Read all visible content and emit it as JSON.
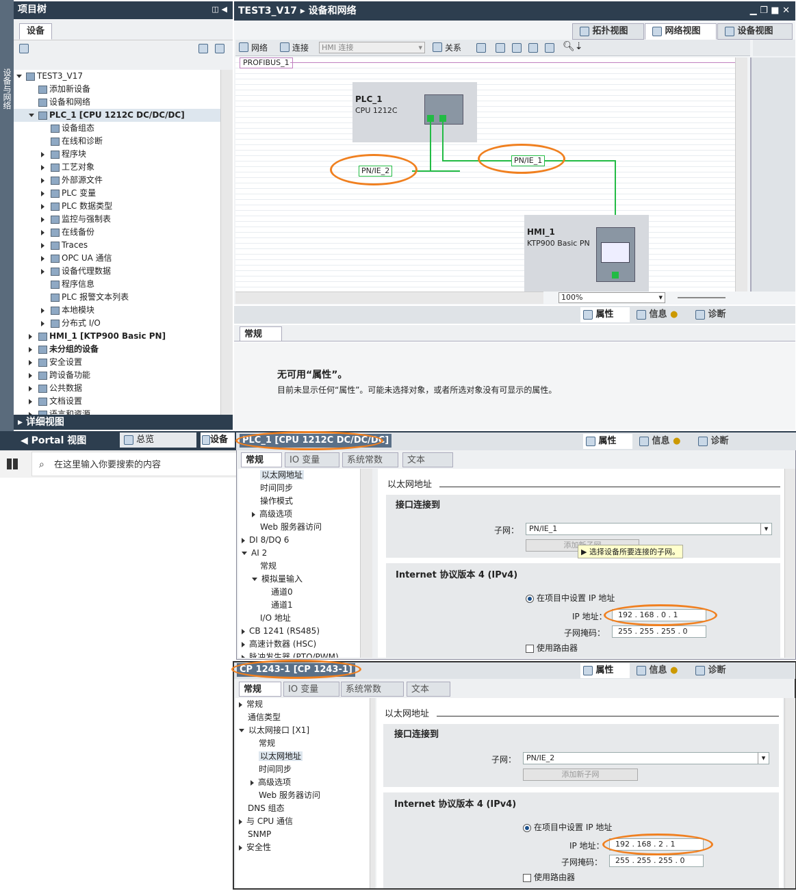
{
  "left": {
    "header": "项目树",
    "tab": "设备",
    "side_label": "设备与网络",
    "items": [
      {
        "label": "TEST3_V17",
        "level": 0,
        "exp": "dn"
      },
      {
        "label": "添加新设备",
        "level": 1,
        "exp": ""
      },
      {
        "label": "设备和网络",
        "level": 1,
        "exp": ""
      },
      {
        "label": "PLC_1 [CPU 1212C DC/DC/DC]",
        "level": 1,
        "exp": "dn"
      },
      {
        "label": "设备组态",
        "level": 2,
        "exp": ""
      },
      {
        "label": "在线和诊断",
        "level": 2,
        "exp": ""
      },
      {
        "label": "程序块",
        "level": 2,
        "exp": "r"
      },
      {
        "label": "工艺对象",
        "level": 2,
        "exp": "r"
      },
      {
        "label": "外部源文件",
        "level": 2,
        "exp": "r"
      },
      {
        "label": "PLC 变量",
        "level": 2,
        "exp": "r"
      },
      {
        "label": "PLC 数据类型",
        "level": 2,
        "exp": "r"
      },
      {
        "label": "监控与强制表",
        "level": 2,
        "exp": "r"
      },
      {
        "label": "在线备份",
        "level": 2,
        "exp": "r"
      },
      {
        "label": "Traces",
        "level": 2,
        "exp": "r"
      },
      {
        "label": "OPC UA 通信",
        "level": 2,
        "exp": "r"
      },
      {
        "label": "设备代理数据",
        "level": 2,
        "exp": "r"
      },
      {
        "label": "程序信息",
        "level": 2,
        "exp": ""
      },
      {
        "label": "PLC 报警文本列表",
        "level": 2,
        "exp": ""
      },
      {
        "label": "本地模块",
        "level": 2,
        "exp": "r"
      },
      {
        "label": "分布式 I/O",
        "level": 2,
        "exp": "r"
      },
      {
        "label": "HMI_1 [KTP900 Basic PN]",
        "level": 1,
        "exp": "r"
      },
      {
        "label": "未分组的设备",
        "level": 1,
        "exp": "r"
      },
      {
        "label": "安全设置",
        "level": 1,
        "exp": "r"
      },
      {
        "label": "跨设备功能",
        "level": 1,
        "exp": "r"
      },
      {
        "label": "公共数据",
        "level": 1,
        "exp": "r"
      },
      {
        "label": "文档设置",
        "level": 1,
        "exp": "r"
      },
      {
        "label": "语言和资源",
        "level": 1,
        "exp": "r"
      }
    ],
    "detail": "详细视图",
    "portal": "Portal 视图",
    "overview": "总览",
    "device_tab": "设备"
  },
  "taskbar": {
    "search_placeholder": "在这里输入你要搜索的内容"
  },
  "main": {
    "title": "TEST3_V17",
    "breadcrumb": "设备和网络",
    "view_tabs": [
      "拓扑视图",
      "网络视图",
      "设备视图"
    ],
    "toolbar": {
      "network": "网络",
      "connect": "连接",
      "conn_type": "HMI 连接",
      "relation": "关系"
    },
    "profibus": "PROFIBUS_1",
    "plc_name": "PLC_1",
    "plc_type": "CPU 1212C",
    "hmi_name": "HMI_1",
    "hmi_type": "KTP900 Basic PN",
    "net1": "PN/IE_1",
    "net2": "PN/IE_2",
    "zoom": "100%"
  },
  "props_top": {
    "tabs": [
      "属性",
      "信息",
      "诊断"
    ],
    "general_tab": "常规",
    "no_prop_title": "无可用“属性”。",
    "no_prop_desc": "目前未显示任何“属性”。可能未选择对象，或者所选对象没有可显示的属性。"
  },
  "panel1": {
    "title": "PLC_1 [CPU 1212C DC/DC/DC]",
    "tabs": [
      "常规",
      "IO 变量",
      "系统常数",
      "文本"
    ],
    "nav": [
      {
        "label": "以太网地址",
        "x": 32,
        "exp": "",
        "sel": true
      },
      {
        "label": "时间同步",
        "x": 32,
        "exp": ""
      },
      {
        "label": "操作模式",
        "x": 32,
        "exp": ""
      },
      {
        "label": "高级选项",
        "x": 20,
        "exp": "r"
      },
      {
        "label": "Web 服务器访问",
        "x": 32,
        "exp": ""
      },
      {
        "label": "DI 8/DQ 6",
        "x": 5,
        "exp": "r"
      },
      {
        "label": "AI 2",
        "x": 5,
        "exp": "dn"
      },
      {
        "label": "常规",
        "x": 32,
        "exp": ""
      },
      {
        "label": "模拟量输入",
        "x": 20,
        "exp": "dn"
      },
      {
        "label": "通道0",
        "x": 48,
        "exp": ""
      },
      {
        "label": "通道1",
        "x": 48,
        "exp": ""
      },
      {
        "label": "I/O 地址",
        "x": 32,
        "exp": ""
      },
      {
        "label": "CB 1241 (RS485)",
        "x": 5,
        "exp": "r"
      },
      {
        "label": "高速计数器 (HSC)",
        "x": 5,
        "exp": "r"
      },
      {
        "label": "脉冲发生器 (PTO/PWM)",
        "x": 5,
        "exp": "r"
      }
    ],
    "section_title": "以太网地址",
    "iface_title": "接口连接到",
    "subnet_label": "子网：",
    "subnet": "PN/IE_1",
    "add_subnet": "添加新子网",
    "tooltip": "选择设备所要连接的子网。",
    "ipv4_title": "Internet 协议版本 4 (IPv4)",
    "set_ip": "在项目中设置 IP 地址",
    "ip_label": "IP 地址：",
    "ip": "192 . 168 . 0   . 1",
    "mask_label": "子网掩码：",
    "mask": "255 . 255 . 255 . 0",
    "router": "使用路由器"
  },
  "panel2": {
    "title": "CP 1243-1 [CP 1243-1]",
    "tabs": [
      "常规",
      "IO 变量",
      "系统常数",
      "文本"
    ],
    "nav": [
      {
        "label": "常规",
        "x": 5,
        "exp": "r"
      },
      {
        "label": "通信类型",
        "x": 18,
        "exp": ""
      },
      {
        "label": "以太网接口 [X1]",
        "x": 5,
        "exp": "dn"
      },
      {
        "label": "常规",
        "x": 34,
        "exp": ""
      },
      {
        "label": "以太网地址",
        "x": 34,
        "exp": "",
        "sel": true
      },
      {
        "label": "时间同步",
        "x": 34,
        "exp": ""
      },
      {
        "label": "高级选项",
        "x": 22,
        "exp": "r"
      },
      {
        "label": "Web 服务器访问",
        "x": 34,
        "exp": ""
      },
      {
        "label": "DNS 组态",
        "x": 18,
        "exp": ""
      },
      {
        "label": "与 CPU 通信",
        "x": 5,
        "exp": "r"
      },
      {
        "label": "SNMP",
        "x": 18,
        "exp": ""
      },
      {
        "label": "安全性",
        "x": 5,
        "exp": "r"
      }
    ],
    "section_title": "以太网地址",
    "iface_title": "接口连接到",
    "subnet_label": "子网：",
    "subnet": "PN/IE_2",
    "add_subnet": "添加新子网",
    "ipv4_title": "Internet 协议版本 4 (IPv4)",
    "set_ip": "在项目中设置 IP 地址",
    "ip_label": "IP 地址：",
    "ip": "192 . 168 . 2   . 1",
    "mask_label": "子网掩码：",
    "mask": "255 . 255 . 255 . 0",
    "router": "使用路由器"
  },
  "colors": {
    "accent": "#f08020",
    "net": "#22bb44",
    "header": "#2d3e4f"
  }
}
